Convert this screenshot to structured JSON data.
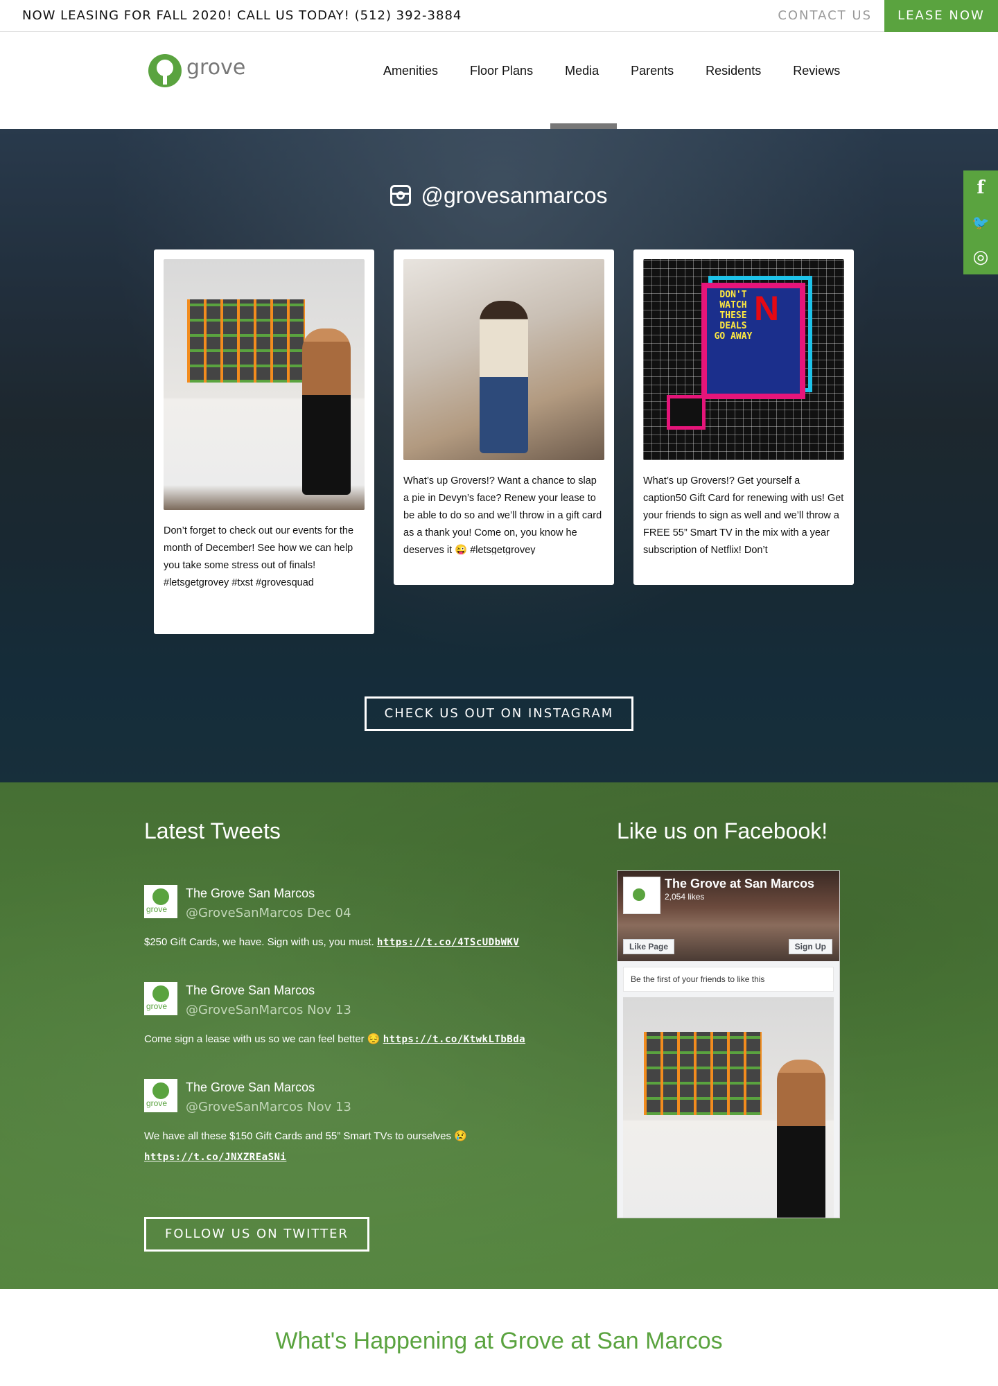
{
  "topbar": {
    "announcement": "NOW LEASING FOR FALL 2020! CALL US TODAY! (512) 392-3884",
    "contact_label": "CONTACT US",
    "lease_label": "LEASE NOW"
  },
  "header": {
    "logo_text": "grove",
    "nav": [
      "Amenities",
      "Floor Plans",
      "Media",
      "Parents",
      "Residents",
      "Reviews"
    ],
    "active_nav": "Media"
  },
  "social": {
    "facebook": "f",
    "twitter": "🐦",
    "instagram": "◎"
  },
  "instagram": {
    "handle": "@grovesanmarcos",
    "posts": [
      {
        "caption": "Don’t forget to check out our events for the month of December! See how we can help you take some stress out of finals! #letsgetgrovey #txst #grovesquad"
      },
      {
        "caption": "What’s up Grovers!? Want a chance to slap a pie in Devyn’s face? Renew your lease to be able to do so and we’ll throw in a gift card as a thank you! Come on, you know he deserves it 😜 #letsgetgrovey"
      },
      {
        "caption": "What’s up Grovers!? Get yourself a caption50 Gift Card for renewing with us! Get your friends to sign as well and we’ll throw a FREE 55” Smart TV in the mix with a year subscription of Netflix! Don’t"
      }
    ],
    "post3_image_text": "DON'T WATCH THESE DEALS GO AWAY",
    "post3_image_letter": "N",
    "button": "CHECK US OUT ON INSTAGRAM"
  },
  "tweets": {
    "title": "Latest Tweets",
    "items": [
      {
        "name": "The Grove San Marcos",
        "handle_date": "@GroveSanMarcos Dec 04",
        "text": "$250 Gift Cards, we have. Sign with us, you must. ",
        "link": "https://t.co/4TScUDbWKV"
      },
      {
        "name": "The Grove San Marcos",
        "handle_date": "@GroveSanMarcos Nov 13",
        "text": "Come sign a lease with us so we can feel better 😔 ",
        "link": "https://t.co/KtwkLTbBda"
      },
      {
        "name": "The Grove San Marcos",
        "handle_date": "@GroveSanMarcos Nov 13",
        "text": "We have all these $150 Gift Cards and 55” Smart TVs to ourselves 😢 ",
        "link": "https://t.co/JNXZREaSNi"
      }
    ],
    "button": "FOLLOW US ON TWITTER"
  },
  "facebook": {
    "title": "Like us on Facebook!",
    "page_name": "The Grove at San Marcos",
    "likes": "2,054 likes",
    "like_button": "Like Page",
    "signup_button": "Sign Up",
    "friends_text": "Be the first of your friends to like this"
  },
  "happening": {
    "title": "What's Happening at Grove at San Marcos"
  },
  "colors": {
    "brand_green": "#5aa33f"
  }
}
